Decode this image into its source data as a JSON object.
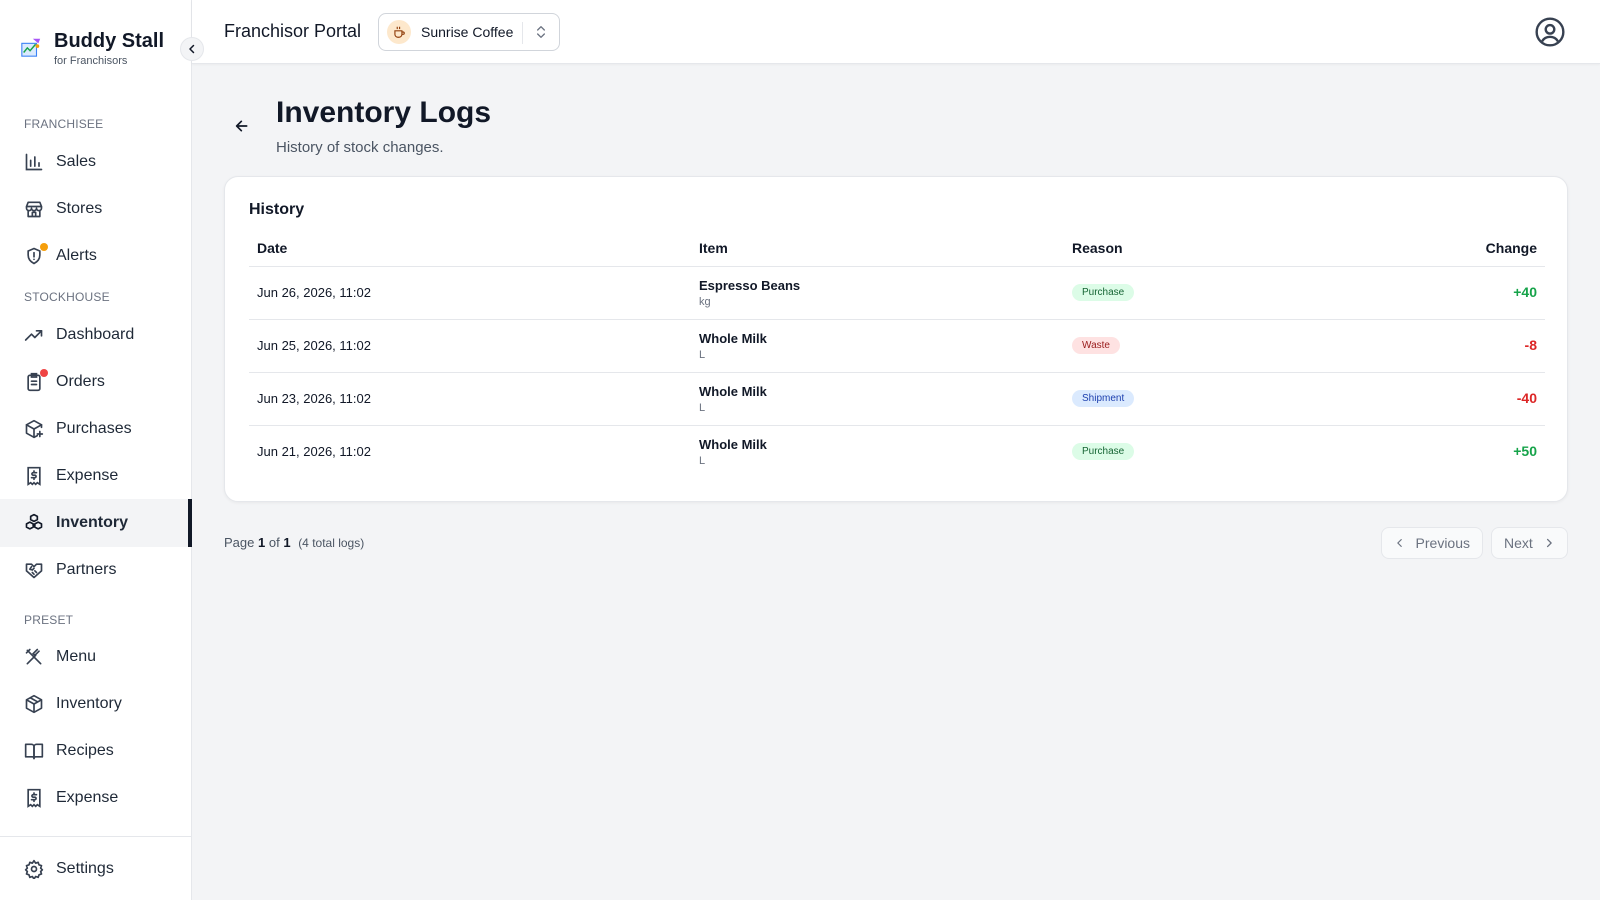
{
  "brand": {
    "title": "Buddy Stall",
    "subtitle": "for Franchisors"
  },
  "sidebar": {
    "sections": [
      {
        "label": "FRANCHISEE"
      },
      {
        "label": "STOCKHOUSE"
      },
      {
        "label": "PRESET"
      }
    ],
    "items": [
      {
        "label": "Sales",
        "icon": "bar-chart-icon"
      },
      {
        "label": "Stores",
        "icon": "store-icon"
      },
      {
        "label": "Alerts",
        "icon": "alert-shield-icon",
        "badge_color": "#f59e0b"
      },
      {
        "label": "Dashboard",
        "icon": "trending-up-icon"
      },
      {
        "label": "Orders",
        "icon": "clipboard-icon",
        "badge_color": "#ef4444"
      },
      {
        "label": "Purchases",
        "icon": "package-plus-icon"
      },
      {
        "label": "Expense",
        "icon": "receipt-dollar-icon"
      },
      {
        "label": "Inventory",
        "icon": "boxes-icon",
        "active": true
      },
      {
        "label": "Partners",
        "icon": "handshake-icon"
      },
      {
        "label": "Menu",
        "icon": "utensils-crossed-icon"
      },
      {
        "label": "Inventory",
        "icon": "package-icon"
      },
      {
        "label": "Recipes",
        "icon": "book-open-icon"
      },
      {
        "label": "Expense",
        "icon": "receipt-dollar-icon"
      },
      {
        "label": "Settings",
        "icon": "gear-icon"
      }
    ]
  },
  "header": {
    "portal_title": "Franchisor Portal",
    "store_name": "Sunrise Coffee"
  },
  "page": {
    "title": "Inventory Logs",
    "subtitle": "History of stock changes."
  },
  "history": {
    "title": "History",
    "columns": [
      "Date",
      "Item",
      "Reason",
      "Change"
    ],
    "rows": [
      {
        "date": "Jun 26, 2026, 11:02",
        "item": "Espresso Beans",
        "unit": "kg",
        "reason": "Purchase",
        "change": "+40"
      },
      {
        "date": "Jun 25, 2026, 11:02",
        "item": "Whole Milk",
        "unit": "L",
        "reason": "Waste",
        "change": "-8"
      },
      {
        "date": "Jun 23, 2026, 11:02",
        "item": "Whole Milk",
        "unit": "L",
        "reason": "Shipment",
        "change": "-40"
      },
      {
        "date": "Jun 21, 2026, 11:02",
        "item": "Whole Milk",
        "unit": "L",
        "reason": "Purchase",
        "change": "+50"
      }
    ]
  },
  "pagination": {
    "page_prefix": "Page",
    "current": "1",
    "of": "of",
    "total_pages": "1",
    "total_logs": "(4 total logs)",
    "previous": "Previous",
    "next": "Next"
  },
  "colors": {
    "positive": "#16a34a",
    "negative": "#dc2626",
    "alerts_dot": "#f59e0b",
    "orders_dot": "#ef4444"
  }
}
